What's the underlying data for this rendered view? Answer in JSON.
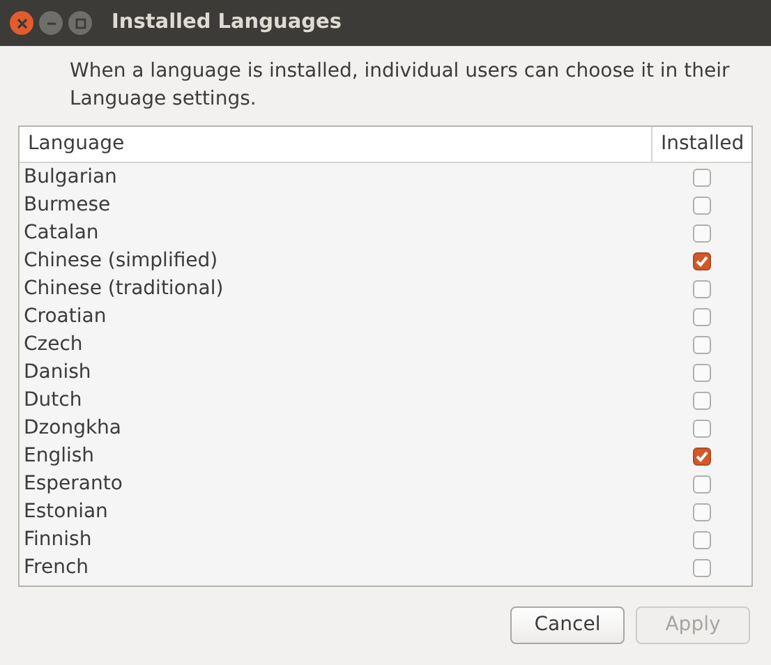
{
  "window": {
    "title": "Installed Languages"
  },
  "description": "When a language is installed, individual users can choose it in their Language settings.",
  "table": {
    "columns": [
      "Language",
      "Installed"
    ],
    "rows": [
      {
        "language": "Bulgarian",
        "installed": false
      },
      {
        "language": "Burmese",
        "installed": false
      },
      {
        "language": "Catalan",
        "installed": false
      },
      {
        "language": "Chinese (simplified)",
        "installed": true
      },
      {
        "language": "Chinese (traditional)",
        "installed": false
      },
      {
        "language": "Croatian",
        "installed": false
      },
      {
        "language": "Czech",
        "installed": false
      },
      {
        "language": "Danish",
        "installed": false
      },
      {
        "language": "Dutch",
        "installed": false
      },
      {
        "language": "Dzongkha",
        "installed": false
      },
      {
        "language": "English",
        "installed": true
      },
      {
        "language": "Esperanto",
        "installed": false
      },
      {
        "language": "Estonian",
        "installed": false
      },
      {
        "language": "Finnish",
        "installed": false
      },
      {
        "language": "French",
        "installed": false
      }
    ]
  },
  "buttons": [
    {
      "label": "Cancel",
      "disabled": false
    },
    {
      "label": "Apply",
      "disabled": true
    }
  ]
}
